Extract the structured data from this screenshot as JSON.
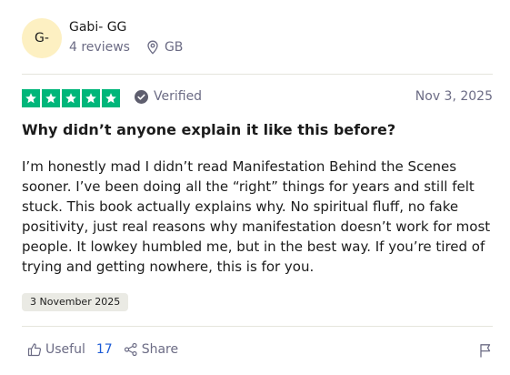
{
  "reviewer": {
    "initials": "G-",
    "name": "Gabi- GG",
    "reviews_count": "4 reviews",
    "location": "GB"
  },
  "rating": {
    "stars": 5,
    "max_stars": 5,
    "verified_label": "Verified"
  },
  "review": {
    "date": "Nov 3, 2025",
    "title": "Why didn’t anyone explain it like this before?",
    "body": "I’m honestly mad I didn’t read Manifestation Behind the Scenes sooner. I’ve been doing all the “right” things for years and still felt stuck. This book actually explains why. No spiritual fluff, no fake positivity, just real reasons why manifestation doesn’t work for most people. It lowkey humbled me, but in the best way. If you’re tired of trying and getting nowhere, this is for you.",
    "experience_date": "3 November 2025"
  },
  "actions": {
    "useful_label": "Useful",
    "useful_count": "17",
    "share_label": "Share"
  },
  "colors": {
    "star_green": "#00b67a",
    "avatar_bg": "#fdf0c2",
    "muted_text": "#6c6c85",
    "link_blue": "#1c5bd6"
  },
  "icons": {
    "location": "location-pin-icon",
    "verified": "verified-check-icon",
    "useful": "thumbs-up-icon",
    "share": "share-icon",
    "report": "flag-icon"
  }
}
